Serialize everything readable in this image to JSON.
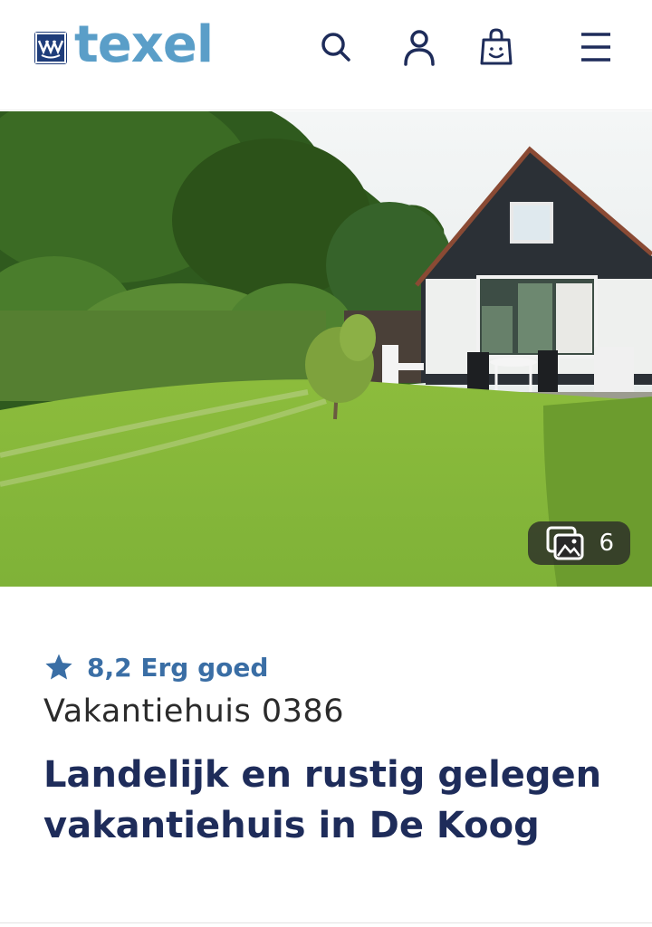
{
  "header": {
    "logo_text": "texel",
    "icons": [
      "search-icon",
      "user-icon",
      "shopping-bag-icon",
      "menu-icon"
    ]
  },
  "hero": {
    "photo_count": "6"
  },
  "listing": {
    "rating": "8,2 Erg goed",
    "type": "Vakantiehuis 0386",
    "title": "Landelijk en rustig gelegen vakantiehuis in De Koog"
  },
  "colors": {
    "brand_blue": "#5a9ec8",
    "dark_navy": "#1e2c5a",
    "rating_blue": "#3a6ea5"
  }
}
